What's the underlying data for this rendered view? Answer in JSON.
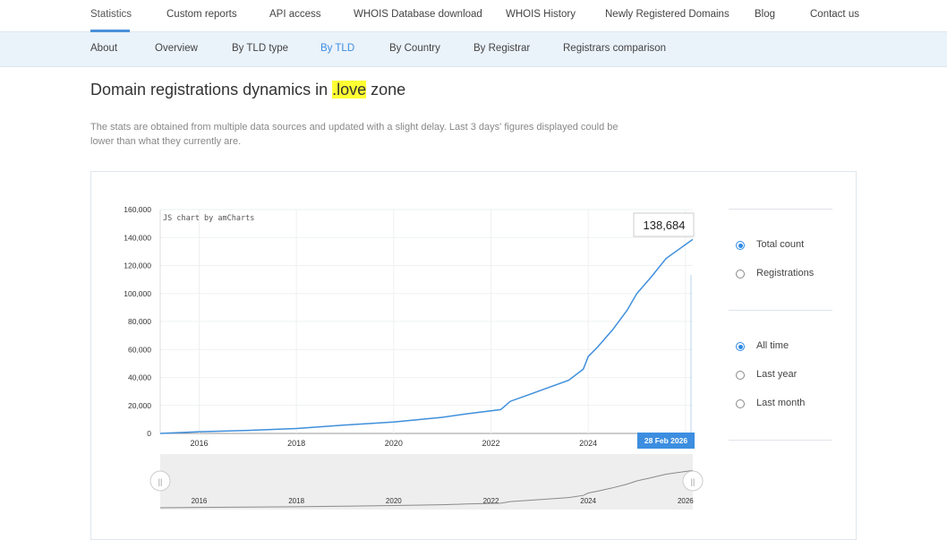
{
  "top_nav": [
    {
      "label": "Statistics",
      "x": 101
    },
    {
      "label": "Custom reports",
      "x": 186
    },
    {
      "label": "API access",
      "x": 301
    },
    {
      "label": "WHOIS Database download",
      "x": 395
    },
    {
      "label": "WHOIS History",
      "x": 565
    },
    {
      "label": "Newly Registered Domains",
      "x": 676
    },
    {
      "label": "Blog",
      "x": 843
    },
    {
      "label": "Contact us",
      "x": 905
    }
  ],
  "sub_nav": [
    {
      "label": "About",
      "x": 101
    },
    {
      "label": "Overview",
      "x": 173
    },
    {
      "label": "By TLD type",
      "x": 259
    },
    {
      "label": "By TLD",
      "x": 358
    },
    {
      "label": "By Country",
      "x": 435
    },
    {
      "label": "By Registrar",
      "x": 529
    },
    {
      "label": "Registrars comparison",
      "x": 629
    }
  ],
  "title": {
    "prefix": "Domain registrations dynamics in ",
    "highlight": ".love",
    "suffix": " zone"
  },
  "note": "The stats are obtained from multiple data sources and updated with a slight delay. Last 3 days' figures displayed could be lower than what they currently are.",
  "options": {
    "metric": [
      {
        "label": "Total count",
        "selected": true
      },
      {
        "label": "Registrations",
        "selected": false
      }
    ],
    "range": [
      {
        "label": "All time",
        "selected": true
      },
      {
        "label": "Last year",
        "selected": false
      },
      {
        "label": "Last month",
        "selected": false
      }
    ]
  },
  "chart_data": {
    "type": "line",
    "credit": "JS chart by amCharts",
    "ylim": [
      0,
      160000
    ],
    "y_ticks": [
      "0",
      "20,000",
      "40,000",
      "60,000",
      "80,000",
      "100,000",
      "120,000",
      "140,000",
      "160,000"
    ],
    "x_ticks": [
      "2016",
      "2018",
      "2020",
      "2022",
      "2024",
      "26"
    ],
    "scroll_ticks": [
      "2016",
      "2018",
      "2020",
      "2022",
      "2024",
      "2026"
    ],
    "last_value_label": "138,684",
    "cursor_date": "28 Feb 2026",
    "series": [
      {
        "x": [
          2015.2,
          2016,
          2017,
          2018,
          2019,
          2020,
          2021,
          2021.5,
          2022.2,
          2022.4,
          2022.8,
          2023.2,
          2023.6,
          2023.9,
          2024.0,
          2024.2,
          2024.5,
          2024.8,
          2025.0,
          2025.3,
          2025.6,
          2026.0,
          2026.15
        ],
        "values": [
          0,
          1200,
          2200,
          3500,
          6000,
          8200,
          11500,
          14000,
          17000,
          23000,
          28000,
          33000,
          38000,
          46000,
          55000,
          62000,
          74000,
          88000,
          100000,
          112000,
          125000,
          135000,
          138684
        ]
      }
    ]
  }
}
